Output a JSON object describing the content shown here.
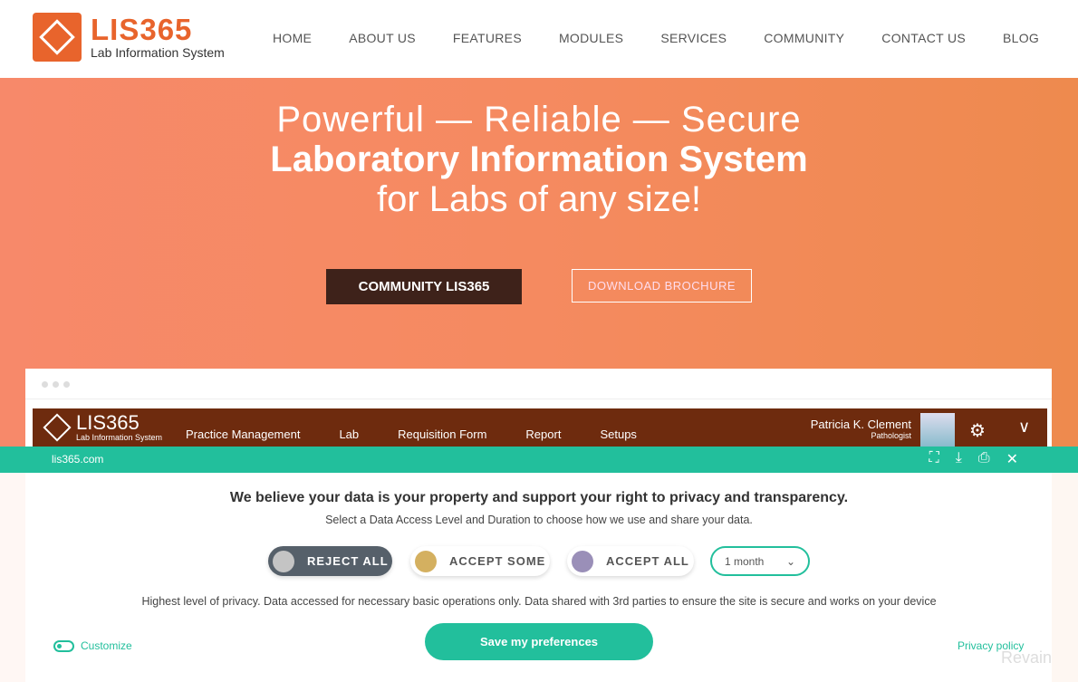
{
  "header": {
    "logo_title": "LIS365",
    "logo_sub": "Lab Information System",
    "nav": [
      "HOME",
      "ABOUT US",
      "FEATURES",
      "MODULES",
      "SERVICES",
      "COMMUNITY",
      "CONTACT US",
      "BLOG"
    ]
  },
  "hero": {
    "line1": "Powerful — Reliable — Secure",
    "line2": "Laboratory Information System",
    "line3": "for Labs of any size!",
    "btn_primary": "COMMUNITY LIS365",
    "btn_secondary": "DOWNLOAD BROCHURE"
  },
  "app": {
    "logo_title": "LIS365",
    "logo_sub": "Lab Information System",
    "nav": [
      "Practice Management",
      "Lab",
      "Requisition Form",
      "Report",
      "Setups"
    ],
    "user_name": "Patricia K. Clement",
    "user_role": "Pathologist"
  },
  "consent": {
    "domain": "lis365.com",
    "title": "We believe your data is your property and support your right to privacy and transparency.",
    "subtitle": "Select a Data Access Level and Duration to choose how we use and share your data.",
    "options": [
      {
        "label": "REJECT ALL",
        "color": "#c4c4c4",
        "selected": true
      },
      {
        "label": "ACCEPT SOME",
        "color": "#d4b060"
      },
      {
        "label": "ACCEPT ALL",
        "color": "#9a8fb8"
      }
    ],
    "duration": "1 month",
    "description": "Highest level of privacy. Data accessed for necessary basic operations only. Data shared with 3rd parties to ensure the site is secure and works on your device",
    "save": "Save my preferences",
    "customize": "Customize",
    "privacy": "Privacy policy"
  },
  "watermark": "Revain",
  "colors": {
    "brand": "#e8642c",
    "teal": "#22bf9c",
    "appbar": "#6e2b0e"
  }
}
